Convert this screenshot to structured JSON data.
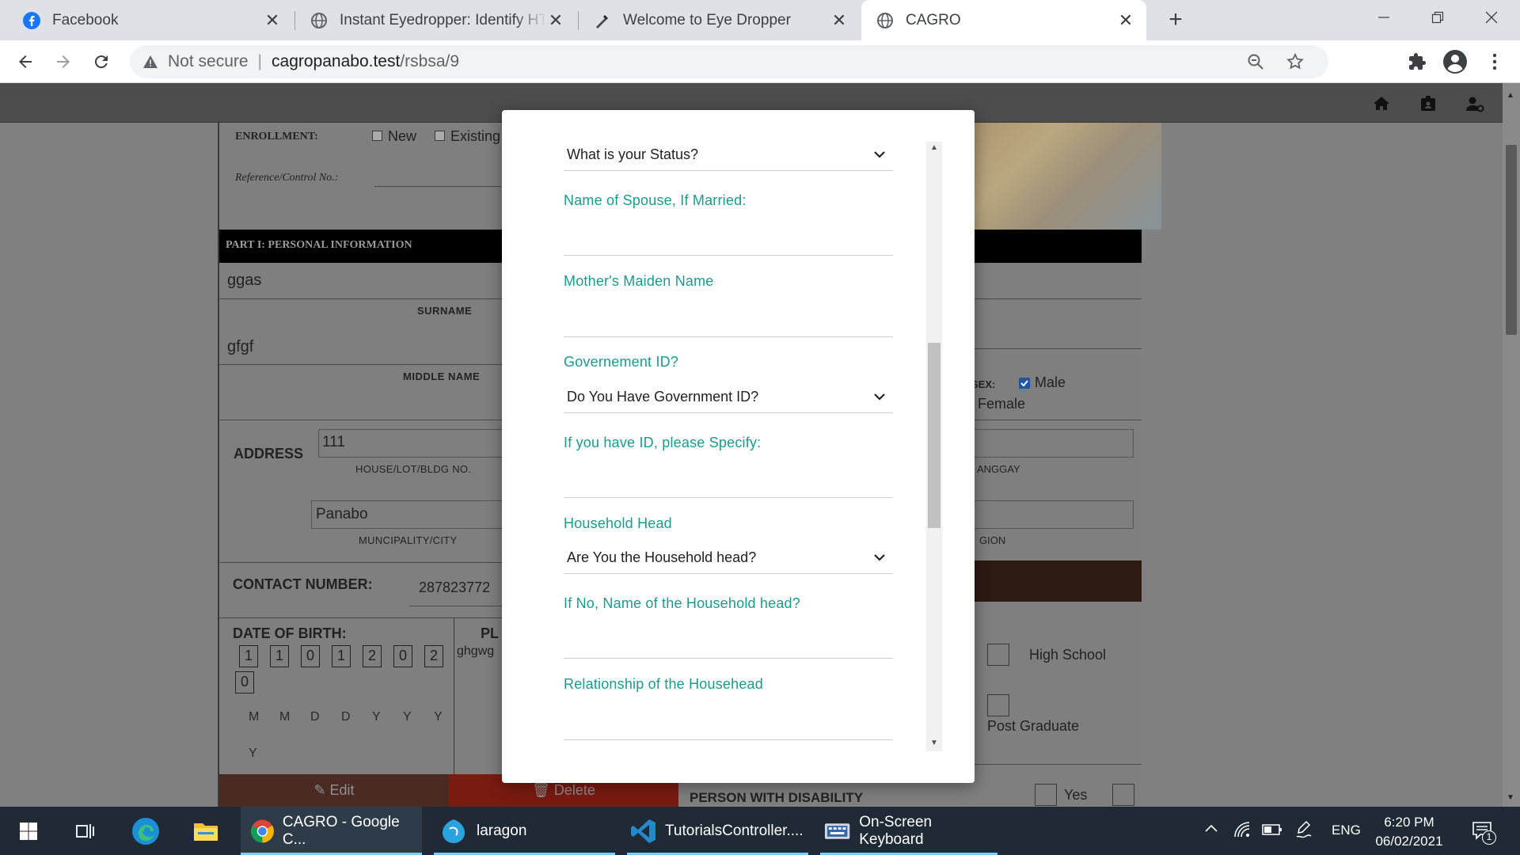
{
  "browser": {
    "tabs": [
      {
        "title": "Facebook",
        "icon": "facebook-icon"
      },
      {
        "title": "Instant Eyedropper: Identify HTML",
        "icon": "globe-icon"
      },
      {
        "title": "Welcome to Eye Dropper",
        "icon": "eyedropper-icon"
      },
      {
        "title": "CAGRO",
        "icon": "globe-icon",
        "active": true
      }
    ],
    "security_label": "Not secure",
    "url_host": "cagropanabo.test",
    "url_path": "/rsbsa/9"
  },
  "form": {
    "enrollment_label": "ENROLLMENT:",
    "new_label": "New",
    "existing_label": "Existing",
    "reference_label": "Reference/Control No.:",
    "part1_header": "PART I: PERSONAL INFORMATION",
    "surname_value": "ggas",
    "surname_label": "SURNAME",
    "middle_value": "gfgf",
    "middle_label": "MIDDLE NAME",
    "sex_label": "SEX:",
    "male_label": "Male",
    "female_label": "Female",
    "address_label": "ADDRESS",
    "house_value": "111",
    "house_label": "HOUSE/LOT/BLDG NO.",
    "barangay_label_partial": "ANGGAY",
    "city_value": "Panabo",
    "city_label": "MUNCIPALITY/CITY",
    "region_label_partial": "GION",
    "contact_label": "CONTACT NUMBER:",
    "contact_value": "287823772",
    "dob_label": "DATE OF BIRTH:",
    "dob_digits": [
      "1",
      "1",
      "0",
      "1",
      "2",
      "0",
      "2",
      "0"
    ],
    "dob_format": [
      "M",
      "M",
      "D",
      "D",
      "Y",
      "Y",
      "Y",
      "Y"
    ],
    "place_label_partial": "PL",
    "place_value_partial": "ghgwg",
    "high_school_label": "High School",
    "post_graduate_label": "Post Graduate",
    "edit_label": "Edit",
    "delete_label": "Delete",
    "pwd_label": "PERSON WITH DISABILITY",
    "yes_label": "Yes"
  },
  "modal": {
    "status_select": "What is your Status?",
    "spouse_label": "Name of Spouse, If Married:",
    "mother_label": "Mother's Maiden Name",
    "gov_id_label": "Governement ID?",
    "gov_id_select": "Do You Have Government ID?",
    "id_specify_label": "If you have ID, please Specify:",
    "household_label": "Household Head",
    "household_select": "Are You the Household head?",
    "household_name_label": "If No, Name of the Household head?",
    "relationship_label": "Relationship of the Househead"
  },
  "taskbar": {
    "apps": [
      {
        "label": "CAGRO - Google C...",
        "icon": "chrome-icon"
      },
      {
        "label": "laragon",
        "icon": "laragon-icon"
      },
      {
        "label": "TutorialsController....",
        "icon": "vscode-icon"
      },
      {
        "label": "On-Screen Keyboard",
        "icon": "keyboard-icon"
      }
    ],
    "language": "ENG",
    "time": "6:20 PM",
    "date": "06/02/2021",
    "notification_count": "1"
  }
}
